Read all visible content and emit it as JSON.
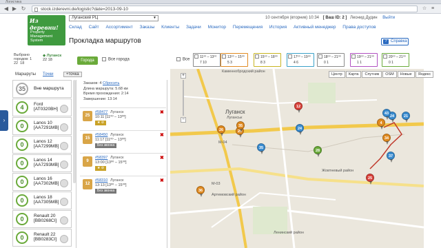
{
  "browser": {
    "tab_title": "Логистика",
    "url": "stock.izderevni.de/logistic?date=2013-09-10"
  },
  "logo": {
    "line1": "Из деревни!",
    "line2": "Property\nManagement\nSystem"
  },
  "header": {
    "city_select": "Луганский РЦ",
    "datetime": "10 сентября (вторник) 10:34",
    "user_id": "[ Ваш ID: 2 ]",
    "user_name": "Леонид Дудин",
    "exit_label": "Выйти"
  },
  "nav": [
    "Склад",
    "Сайт",
    "Ассортимент",
    "Заказы",
    "Клиенты",
    "Задачи",
    "Монитор",
    "Перемещения",
    "История",
    "Активный менеджер",
    "Права доступов"
  ],
  "page": {
    "title": "Прокладка маршрутов",
    "help_label": "Справка"
  },
  "filters": {
    "chosen_label": "Выбрано\nгородов: 1\n22  18",
    "city_name": "Луганск",
    "city_counts": "22  18",
    "city_button": "Города",
    "all_cities": "Все города",
    "all": "Все",
    "slots": [
      {
        "time": "11⁰⁰ – 13⁰⁰",
        "counts": "7  10",
        "color": "#8a8a8a"
      },
      {
        "time": "13⁰⁰ – 15⁰⁰",
        "counts": "5  3",
        "color": "#e08a20"
      },
      {
        "time": "15⁰⁰ – 18⁰⁰",
        "counts": "8  3",
        "color": "#c8b420"
      },
      {
        "time": "17⁰⁰ – 19⁰⁰",
        "counts": "4  6",
        "color": "#3aa0c8"
      },
      {
        "time": "18⁰⁰ – 21⁰⁰",
        "counts": "0  1",
        "color": "#8a8a8a"
      },
      {
        "time": "19⁰⁰ – 21⁰⁰",
        "counts": "1  1",
        "color": "#b050c0"
      },
      {
        "time": "20⁰⁰ – 21⁰⁰",
        "counts": "0  1",
        "color": "#6aaa3a"
      }
    ]
  },
  "tabs": {
    "routes": "Маршруты",
    "points": "Точки",
    "new": "+точка"
  },
  "routes": [
    {
      "num": "35",
      "name": "Вне маршрута"
    },
    {
      "num": "4",
      "name": "Ford\n[AT0320BH]"
    },
    {
      "num": "0",
      "name": "Lanos 10\n[AA7291MB]"
    },
    {
      "num": "0",
      "name": "Lanos 12\n[AA7299MB]"
    },
    {
      "num": "0",
      "name": "Lanos 14\n[AA7293MB]"
    },
    {
      "num": "0",
      "name": "Lanos 16\n[AA7302MB]"
    },
    {
      "num": "0",
      "name": "Lanos 18\n[AA7305MB]"
    },
    {
      "num": "0",
      "name": "Renault 20\n[BB0268CI]"
    },
    {
      "num": "0",
      "name": "Renault 22\n[BB0283CI]"
    }
  ],
  "summary": {
    "orders": "Заказов: 4",
    "reset": "Сбросить",
    "length": "Длина маршрута: 5.68 км",
    "time": "Время прохождения: 2:14",
    "finish": "Завершение: 13:14"
  },
  "orders": [
    {
      "weight": "25",
      "id": "#58477",
      "city": "Луганск",
      "time": "10:11 [11⁰⁰ – 13⁰⁰]",
      "tag": ""
    },
    {
      "weight": "15",
      "id": "#58450",
      "city": "Луганск",
      "time": "11:17 [11⁰⁰ – 13⁰⁰]",
      "tag": "Без звонка"
    },
    {
      "weight": "9",
      "id": "#58397",
      "city": "Луганск",
      "time": "13:00 [13⁰⁰ – 15⁰⁰]",
      "tag": ""
    },
    {
      "weight": "12",
      "id": "#58310",
      "city": "Луганск",
      "time": "13:13 [13⁰⁰ – 15⁰⁰]",
      "tag": "Без звонка"
    }
  ],
  "map": {
    "buttons": [
      "Центр",
      "Карта",
      "Спутник",
      "OSM",
      "Новые",
      "Яндекс"
    ],
    "labels": [
      "Каменнобродский район",
      "Луганск",
      "Луганськ",
      "Жовтневый район",
      "Артемовский район",
      "Ленинский район",
      "M-04",
      "M-03"
    ],
    "pins": [
      {
        "n": "12",
        "c": "#d9413a"
      },
      {
        "n": "24",
        "c": "#3a8cd0"
      },
      {
        "n": "25",
        "c": "#e08a20"
      },
      {
        "n": "26",
        "c": "#e08a20"
      },
      {
        "n": "35",
        "c": "#e08a20"
      },
      {
        "n": "35",
        "c": "#3a8cd0"
      },
      {
        "n": "28",
        "c": "#6aaa3a"
      },
      {
        "n": "36",
        "c": "#e08a20"
      },
      {
        "n": "24",
        "c": "#3a8cd0"
      },
      {
        "n": "43",
        "c": "#3a8cd0"
      },
      {
        "n": "21",
        "c": "#3a8cd0"
      },
      {
        "n": "34",
        "c": "#e08a20"
      },
      {
        "n": "37",
        "c": "#3a8cd0"
      },
      {
        "n": "25",
        "c": "#d9413a"
      },
      {
        "n": "4",
        "c": "#e08a20"
      }
    ]
  }
}
